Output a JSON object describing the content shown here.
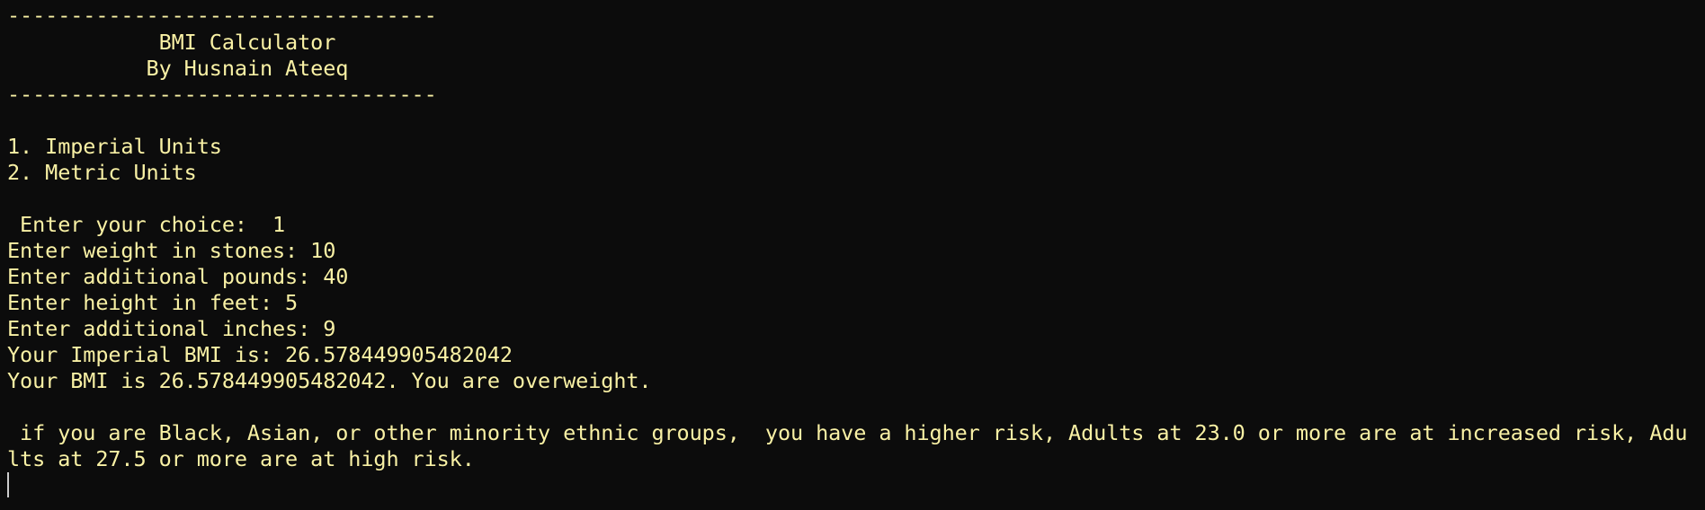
{
  "terminal": {
    "lines": [
      "----------------------------------",
      "            BMI Calculator",
      "           By Husnain Ateeq",
      "----------------------------------",
      "",
      "1. Imperial Units",
      "2. Metric Units",
      "",
      " Enter your choice:  1",
      "Enter weight in stones: 10",
      "Enter additional pounds: 40",
      "Enter height in feet: 5",
      "Enter additional inches: 9",
      "Your Imperial BMI is: 26.578449905482042",
      "Your BMI is 26.578449905482042. You are overweight.",
      "",
      " if you are Black, Asian, or other minority ethnic groups,  you have a higher risk, Adults at 23.0 or more are at increased risk, Adu",
      "lts at 27.5 or more are at high risk."
    ],
    "text_color": "#f9f1a5",
    "background_color": "#0c0c0c"
  }
}
